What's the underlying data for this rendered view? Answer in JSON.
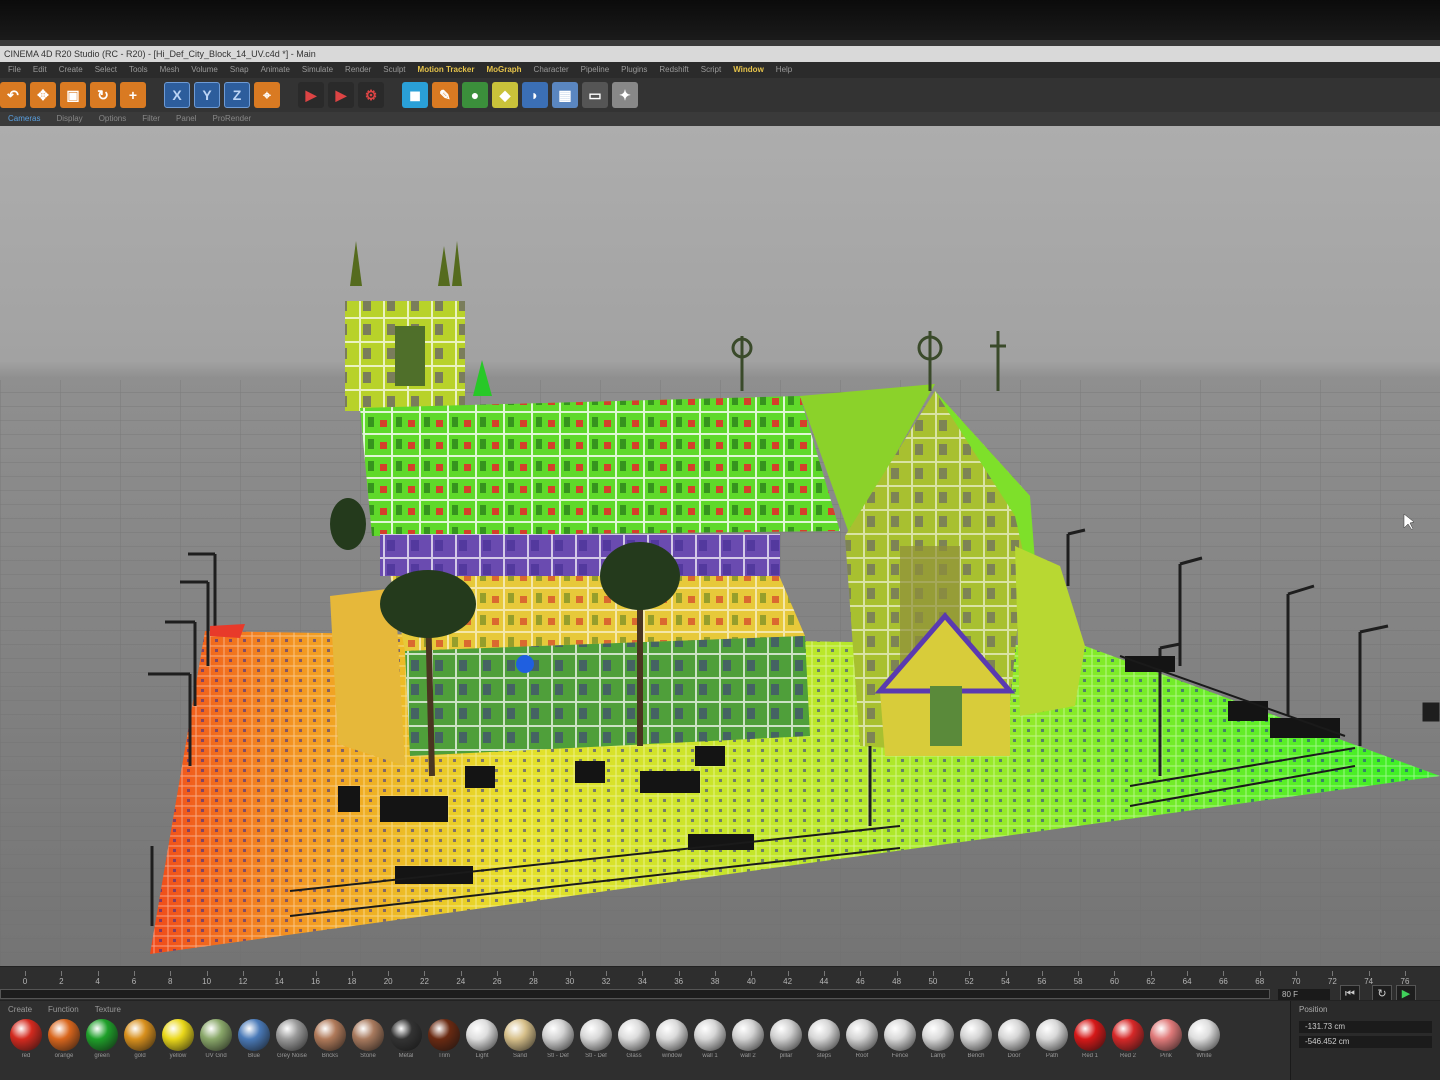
{
  "window": {
    "title": "CINEMA 4D R20 Studio (RC - R20) - [Hi_Def_City_Block_14_UV.c4d *] - Main"
  },
  "menu": [
    "File",
    "Edit",
    "Create",
    "Select",
    "Tools",
    "Mesh",
    "Volume",
    "Snap",
    "Animate",
    "Simulate",
    "Render",
    "Sculpt",
    "Motion Tracker",
    "MoGraph",
    "Character",
    "Pipeline",
    "Plugins",
    "Redshift",
    "Script",
    "Window",
    "Help"
  ],
  "menu_highlight": [
    "Motion Tracker",
    "MoGraph",
    "Window"
  ],
  "toolbar": {
    "axis_x": "X",
    "axis_y": "Y",
    "axis_z": "Z"
  },
  "view_menu": [
    "Cameras",
    "Display",
    "Options",
    "Filter",
    "Panel",
    "ProRender"
  ],
  "timeline": {
    "ticks": [
      "0",
      "2",
      "4",
      "6",
      "8",
      "10",
      "12",
      "14",
      "16",
      "18",
      "20",
      "22",
      "24",
      "26",
      "28",
      "30",
      "32",
      "34",
      "36",
      "38",
      "40",
      "42",
      "44",
      "46",
      "48",
      "50",
      "52",
      "54",
      "56",
      "58",
      "60",
      "62",
      "64",
      "66",
      "68",
      "70",
      "72",
      "74",
      "76"
    ],
    "frame": "80 F"
  },
  "materials": {
    "tabs": [
      "Create",
      "Function",
      "Texture"
    ],
    "items": [
      {
        "label": "red",
        "color": "#d42a1f"
      },
      {
        "label": "orange",
        "color": "#d9661d"
      },
      {
        "label": "green",
        "color": "#1fa02a"
      },
      {
        "label": "gold",
        "color": "#d8901d"
      },
      {
        "label": "yellow",
        "color": "#ead81a"
      },
      {
        "label": "UV Grid",
        "color": "#8aa86a"
      },
      {
        "label": "Blue",
        "color": "#4a7ab8"
      },
      {
        "label": "Grey Noise",
        "color": "#9a9a9a"
      },
      {
        "label": "Bricks",
        "color": "#b07a5a"
      },
      {
        "label": "Stone",
        "color": "#a87a5e"
      },
      {
        "label": "Metal",
        "color": "#333333"
      },
      {
        "label": "Trim",
        "color": "#6a2a12"
      },
      {
        "label": "Light",
        "color": "#dedede"
      },
      {
        "label": "Sand",
        "color": "#d7c08a"
      },
      {
        "label": "Stl - Def",
        "color": "#d2d2d2"
      },
      {
        "label": "Stl - Def",
        "color": "#d8d8d8"
      },
      {
        "label": "Glass",
        "color": "#dcdcdc"
      },
      {
        "label": "window",
        "color": "#dadada"
      },
      {
        "label": "wall 1",
        "color": "#d6d6d6"
      },
      {
        "label": "wall 2",
        "color": "#d2d2d2"
      },
      {
        "label": "pillar",
        "color": "#d0d0d0"
      },
      {
        "label": "steps",
        "color": "#d6d6d6"
      },
      {
        "label": "Roof",
        "color": "#d4d4d4"
      },
      {
        "label": "Fence",
        "color": "#d8d8d8"
      },
      {
        "label": "Lamp",
        "color": "#dadada"
      },
      {
        "label": "Bench",
        "color": "#d4d4d4"
      },
      {
        "label": "Door",
        "color": "#d6d6d6"
      },
      {
        "label": "Path",
        "color": "#d8d8d8"
      },
      {
        "label": "Red 1",
        "color": "#d61818"
      },
      {
        "label": "Red 2",
        "color": "#d62828"
      },
      {
        "label": "Pink",
        "color": "#e07a7a"
      },
      {
        "label": "White",
        "color": "#dedede"
      }
    ]
  },
  "attributes": {
    "title": "Position",
    "x": "-131.73 cm",
    "y": "-546.452 cm"
  }
}
